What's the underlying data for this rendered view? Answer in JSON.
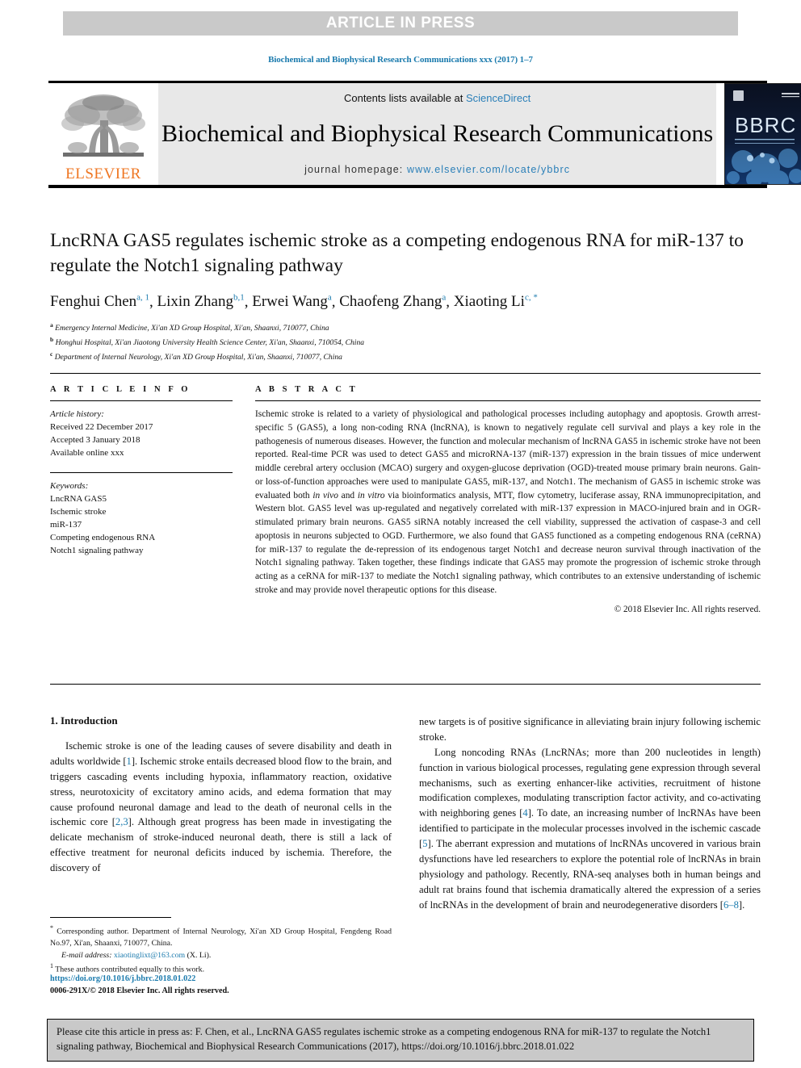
{
  "banner": {
    "text": "ARTICLE IN PRESS"
  },
  "running_head": {
    "text": "Biochemical and Biophysical Research Communications xxx (2017) 1–7"
  },
  "masthead": {
    "publisher_wordmark": "ELSEVIER",
    "contents_prefix": "Contents lists available at ",
    "contents_link": "ScienceDirect",
    "journal_title": "Biochemical and Biophysical Research Communications",
    "homepage_prefix": "journal homepage: ",
    "homepage_url": "www.elsevier.com/locate/ybbrc",
    "cover_label": "BBRC"
  },
  "article": {
    "title": "LncRNA GAS5 regulates ischemic stroke as a competing endogenous RNA for miR-137 to regulate the Notch1 signaling pathway",
    "authors": [
      {
        "name": "Fenghui Chen",
        "marks": "a, 1"
      },
      {
        "name": "Lixin Zhang",
        "marks": "b,1"
      },
      {
        "name": "Erwei Wang",
        "marks": "a"
      },
      {
        "name": "Chaofeng Zhang",
        "marks": "a"
      },
      {
        "name": "Xiaoting Li",
        "marks": "c, *"
      }
    ],
    "affiliations": [
      {
        "mark": "a",
        "text": "Emergency Internal Medicine, Xi'an XD Group Hospital, Xi'an, Shaanxi, 710077, China"
      },
      {
        "mark": "b",
        "text": "Honghui Hospital, Xi'an Jiaotong University Health Science Center, Xi'an, Shaanxi, 710054, China"
      },
      {
        "mark": "c",
        "text": "Department of Internal Neurology, Xi'an XD Group Hospital, Xi'an, Shaanxi, 710077, China"
      }
    ]
  },
  "article_info": {
    "label": "A R T I C L E   I N F O",
    "history_label": "Article history:",
    "history": [
      "Received 22 December 2017",
      "Accepted 3 January 2018",
      "Available online xxx"
    ],
    "keywords_label": "Keywords:",
    "keywords": [
      "LncRNA GAS5",
      "Ischemic stroke",
      "miR-137",
      "Competing endogenous RNA",
      "Notch1 signaling pathway"
    ]
  },
  "abstract": {
    "label": "A B S T R A C T",
    "part1": "Ischemic stroke is related to a variety of physiological and pathological processes including autophagy and apoptosis. Growth arrest-specific 5 (GAS5), a long non-coding RNA (lncRNA), is known to negatively regulate cell survival and plays a key role in the pathogenesis of numerous diseases. However, the function and molecular mechanism of lncRNA GAS5 in ischemic stroke have not been reported. Real-time PCR was used to detect GAS5 and microRNA-137 (miR-137) expression in the brain tissues of mice underwent middle cerebral artery occlusion (MCAO) surgery and oxygen-glucose deprivation (OGD)-treated mouse primary brain neurons. Gain- or loss-of-function approaches were used to manipulate GAS5, miR-137, and Notch1. The mechanism of GAS5 in ischemic stroke was evaluated both ",
    "italic1": "in vivo",
    "part2": " and ",
    "italic2": "in vitro",
    "part3": " via bioinformatics analysis, MTT, flow cytometry, luciferase assay, RNA immunoprecipitation, and Western blot. GAS5 level was up-regulated and negatively correlated with miR-137 expression in MACO-injured brain and in OGR-stimulated primary brain neurons. GAS5 siRNA notably increased the cell viability, suppressed the activation of caspase-3 and cell apoptosis in neurons subjected to OGD. Furthermore, we also found that GAS5 functioned as a competing endogenous RNA (ceRNA) for miR-137 to regulate the de-repression of its endogenous target Notch1 and decrease neuron survival through inactivation of the Notch1 signaling pathway. Taken together, these findings indicate that GAS5 may promote the progression of ischemic stroke through acting as a ceRNA for miR-137 to mediate the Notch1 signaling pathway, which contributes to an extensive understanding of ischemic stroke and may provide novel therapeutic options for this disease.",
    "copyright": "© 2018 Elsevier Inc. All rights reserved."
  },
  "introduction": {
    "heading": "1. Introduction",
    "left_p1_a": "Ischemic stroke is one of the leading causes of severe disability and death in adults worldwide [",
    "left_p1_ref1": "1",
    "left_p1_b": "]. Ischemic stroke entails decreased blood flow to the brain, and triggers cascading events including hypoxia, inflammatory reaction, oxidative stress, neurotoxicity of excitatory amino acids, and edema formation that may cause profound neuronal damage and lead to the death of neuronal cells in the ischemic core [",
    "left_p1_ref2": "2,3",
    "left_p1_c": "]. Although great progress has been made in investigating the delicate mechanism of stroke-induced neuronal death, there is still a lack of effective treatment for neuronal deficits induced by ischemia. Therefore, the discovery of",
    "right_p1": "new targets is of positive significance in alleviating brain injury following ischemic stroke.",
    "right_p2_a": "Long noncoding RNAs (LncRNAs; more than 200 nucleotides in length) function in various biological processes, regulating gene expression through several mechanisms, such as exerting enhancer-like activities, recruitment of histone modification complexes, modulating transcription factor activity, and co-activating with neighboring genes [",
    "right_p2_ref1": "4",
    "right_p2_b": "]. To date, an increasing number of lncRNAs have been identified to participate in the molecular processes involved in the ischemic cascade [",
    "right_p2_ref2": "5",
    "right_p2_c": "]. The aberrant expression and mutations of lncRNAs uncovered in various brain dysfunctions have led researchers to explore the potential role of lncRNAs in brain physiology and pathology. Recently, RNA-seq analyses both in human beings and adult rat brains found that ischemia dramatically altered the expression of a series of lncRNAs in the development of brain and neurodegenerative disorders [",
    "right_p2_ref3": "6–8",
    "right_p2_d": "]."
  },
  "footnotes": {
    "corresponding_mark": "*",
    "corresponding": "Corresponding author. Department of Internal Neurology, Xi'an XD Group Hospital, Fengdeng Road No.97, Xi'an, Shaanxi, 710077, China.",
    "email_label": "E-mail address:",
    "email": "xiaotinglixt@163.com",
    "email_suffix": "(X. Li).",
    "equal_mark": "1",
    "equal_contrib": "These authors contributed equally to this work."
  },
  "doi_block": {
    "doi_url": "https://doi.org/10.1016/j.bbrc.2018.01.022",
    "issn_line": "0006-291X/© 2018 Elsevier Inc. All rights reserved."
  },
  "cite_box": {
    "text": "Please cite this article in press as: F. Chen, et al., LncRNA GAS5 regulates ischemic stroke as a competing endogenous RNA for miR-137 to regulate the Notch1 signaling pathway, Biochemical and Biophysical Research Communications (2017), https://doi.org/10.1016/j.bbrc.2018.01.022"
  },
  "colors": {
    "link": "#1a7aad",
    "banner_bg": "#c9c9c9",
    "masthead_bg": "#e8e8e8",
    "elsevier_orange": "#ef7622"
  }
}
